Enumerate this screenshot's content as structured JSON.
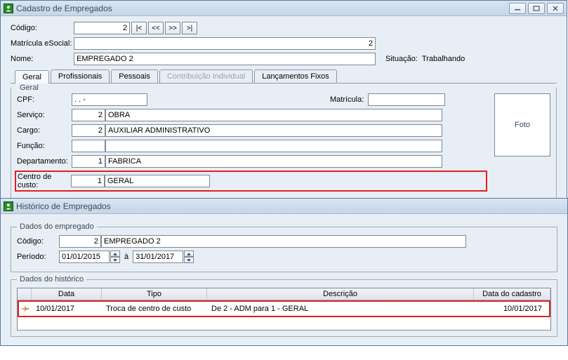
{
  "win1": {
    "title": "Cadastro de Empregados",
    "labels": {
      "codigo": "Código:",
      "matricula_esocial": "Matrícula eSocial:",
      "nome": "Nome:",
      "situacao": "Situação:",
      "cpf": "CPF:",
      "matricula": "Matrícula:",
      "servico": "Serviço:",
      "cargo": "Cargo:",
      "funcao": "Função:",
      "departamento": "Departamento:",
      "centro_custo": "Centro de custo:",
      "foto": "Foto"
    },
    "nav": {
      "first": "|<",
      "prev": "<<",
      "next": ">>",
      "last": ">|"
    },
    "tabs": {
      "geral": "Geral",
      "profissionais": "Profissionais",
      "pessoais": "Pessoais",
      "contribuicao": "Contribuição Individual",
      "lancamentos": "Lançamentos Fixos",
      "fieldset": "Geral"
    },
    "values": {
      "codigo": "2",
      "matricula_esocial": "2",
      "nome": "EMPREGADO 2",
      "situacao": "Trabalhando",
      "cpf": "   .   .   -",
      "matricula": "",
      "servico_cod": "2",
      "servico_nome": "OBRA",
      "cargo_cod": "2",
      "cargo_nome": "AUXILIAR ADMINISTRATIVO",
      "funcao_cod": "",
      "funcao_nome": "",
      "departamento_cod": "1",
      "departamento_nome": "FABRICA",
      "centro_custo_cod": "1",
      "centro_custo_nome": "GERAL"
    }
  },
  "win2": {
    "title": "Histórico de Empregados",
    "fieldsets": {
      "dados_empregado": "Dados do empregado",
      "dados_historico": "Dados do histórico"
    },
    "labels": {
      "codigo": "Código:",
      "periodo": "Período:",
      "ate": "à"
    },
    "values": {
      "codigo": "2",
      "nome": "EMPREGADO 2",
      "periodo_de": "01/01/2015",
      "periodo_ate": "31/01/2017"
    },
    "grid": {
      "headers": {
        "data": "Data",
        "tipo": "Tipo",
        "descricao": "Descrição",
        "data_cadastro": "Data do cadastro"
      },
      "rows": [
        {
          "data": "10/01/2017",
          "tipo": "Troca de centro de custo",
          "descricao": "De 2 - ADM para 1 - GERAL",
          "data_cadastro": "10/01/2017"
        }
      ]
    }
  }
}
